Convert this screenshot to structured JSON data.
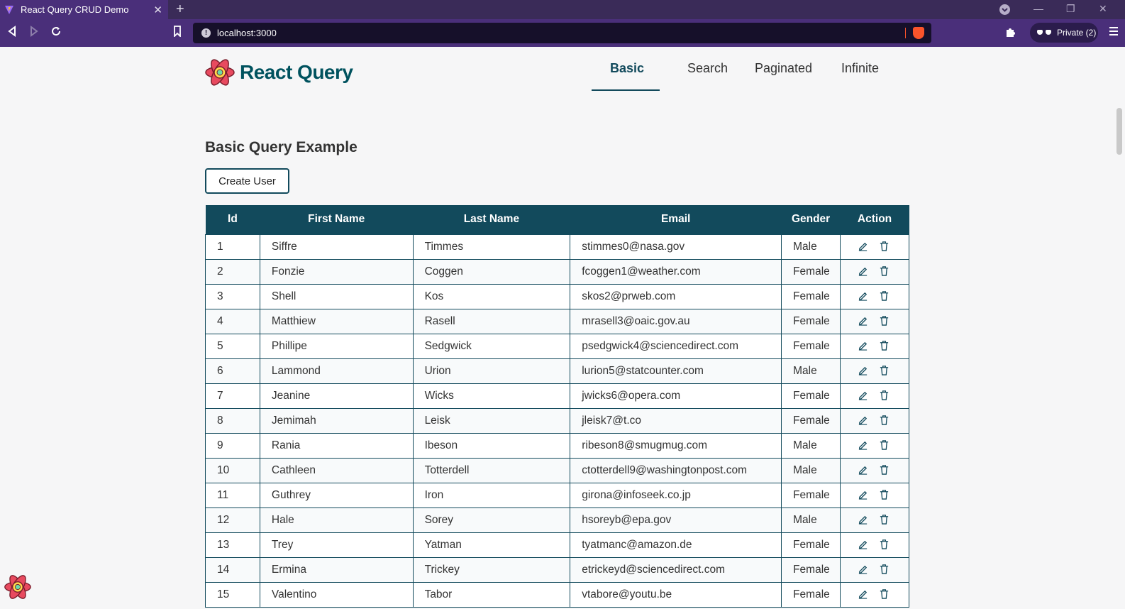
{
  "browser": {
    "tab_title": "React Query CRUD Demo",
    "url": "localhost:3000",
    "private_label": "Private (2)"
  },
  "header": {
    "logo_text": "React Query",
    "nav": [
      {
        "label": "Basic",
        "active": true
      },
      {
        "label": "Search",
        "active": false
      },
      {
        "label": "Paginated",
        "active": false
      },
      {
        "label": "Infinite",
        "active": false
      }
    ]
  },
  "main": {
    "title": "Basic Query Example",
    "create_button": "Create User",
    "columns": [
      "Id",
      "First Name",
      "Last Name",
      "Email",
      "Gender",
      "Action"
    ],
    "rows": [
      {
        "id": "1",
        "first": "Siffre",
        "last": "Timmes",
        "email": "stimmes0@nasa.gov",
        "gender": "Male"
      },
      {
        "id": "2",
        "first": "Fonzie",
        "last": "Coggen",
        "email": "fcoggen1@weather.com",
        "gender": "Female"
      },
      {
        "id": "3",
        "first": "Shell",
        "last": "Kos",
        "email": "skos2@prweb.com",
        "gender": "Female"
      },
      {
        "id": "4",
        "first": "Matthiew",
        "last": "Rasell",
        "email": "mrasell3@oaic.gov.au",
        "gender": "Female"
      },
      {
        "id": "5",
        "first": "Phillipe",
        "last": "Sedgwick",
        "email": "psedgwick4@sciencedirect.com",
        "gender": "Female"
      },
      {
        "id": "6",
        "first": "Lammond",
        "last": "Urion",
        "email": "lurion5@statcounter.com",
        "gender": "Male"
      },
      {
        "id": "7",
        "first": "Jeanine",
        "last": "Wicks",
        "email": "jwicks6@opera.com",
        "gender": "Female"
      },
      {
        "id": "8",
        "first": "Jemimah",
        "last": "Leisk",
        "email": "jleisk7@t.co",
        "gender": "Female"
      },
      {
        "id": "9",
        "first": "Rania",
        "last": "Ibeson",
        "email": "ribeson8@smugmug.com",
        "gender": "Male"
      },
      {
        "id": "10",
        "first": "Cathleen",
        "last": "Totterdell",
        "email": "ctotterdell9@washingtonpost.com",
        "gender": "Male"
      },
      {
        "id": "11",
        "first": "Guthrey",
        "last": "Iron",
        "email": "girona@infoseek.co.jp",
        "gender": "Female"
      },
      {
        "id": "12",
        "first": "Hale",
        "last": "Sorey",
        "email": "hsoreyb@epa.gov",
        "gender": "Male"
      },
      {
        "id": "13",
        "first": "Trey",
        "last": "Yatman",
        "email": "tyatmanc@amazon.de",
        "gender": "Female"
      },
      {
        "id": "14",
        "first": "Ermina",
        "last": "Trickey",
        "email": "etrickeyd@sciencedirect.com",
        "gender": "Female"
      },
      {
        "id": "15",
        "first": "Valentino",
        "last": "Tabor",
        "email": "vtabore@youtu.be",
        "gender": "Female"
      }
    ]
  },
  "colors": {
    "accent": "#124a5c",
    "logo_red": "#e84a5f"
  },
  "icons": {
    "edit": "pencil-icon",
    "delete": "trash-icon"
  }
}
